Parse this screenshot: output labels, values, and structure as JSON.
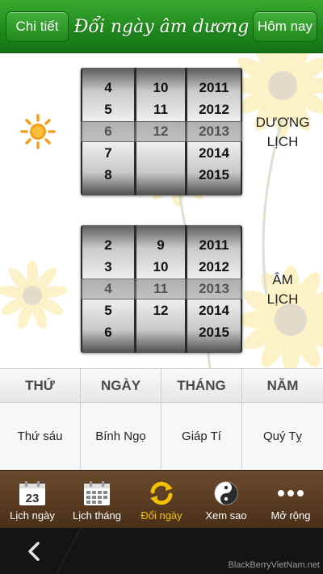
{
  "header": {
    "left_button": "Chi tiết",
    "title": "Đổi ngày âm dương",
    "right_button": "Hôm nay"
  },
  "solar": {
    "label_line1": "DƯƠNG",
    "label_line2": "LỊCH",
    "icon": "sun-icon",
    "day_column": [
      "4",
      "5",
      "6",
      "7",
      "8"
    ],
    "month_column": [
      "10",
      "11",
      "12"
    ],
    "year_column": [
      "2011",
      "2012",
      "2013",
      "2014",
      "2015"
    ],
    "selected": {
      "day": "6",
      "month": "12",
      "year": "2013"
    }
  },
  "lunar": {
    "label_line1": "ÂM",
    "label_line2": "LỊCH",
    "icon": "moon-icon",
    "day_column": [
      "2",
      "3",
      "4",
      "5",
      "6"
    ],
    "month_column": [
      "9",
      "10",
      "11",
      "12"
    ],
    "year_column": [
      "2011",
      "2012",
      "2013",
      "2014",
      "2015"
    ],
    "selected": {
      "day": "4",
      "month": "11",
      "year": "2013"
    }
  },
  "table": {
    "headers": [
      "THỨ",
      "NGÀY",
      "THÁNG",
      "NĂM"
    ],
    "values": [
      "Thứ sáu",
      "Bính Ngọ",
      "Giáp Tí",
      "Quý Tỵ"
    ]
  },
  "tabs": [
    {
      "label": "Lịch ngày",
      "icon": "calendar-day-icon",
      "badge": "23"
    },
    {
      "label": "Lịch tháng",
      "icon": "calendar-month-icon"
    },
    {
      "label": "Đổi ngày",
      "icon": "convert-icon",
      "active": true
    },
    {
      "label": "Xem sao",
      "icon": "yin-yang-icon"
    },
    {
      "label": "Mở rộng",
      "icon": "more-icon"
    }
  ],
  "nav": {
    "back_icon": "back-icon"
  },
  "watermark": "BlackBerryVietNam.net",
  "colors": {
    "header_green": "#1f8a1c",
    "tabbar_brown": "#5a3c22",
    "active_tab": "#f2c200",
    "sun_orange": "#f5a01a"
  }
}
